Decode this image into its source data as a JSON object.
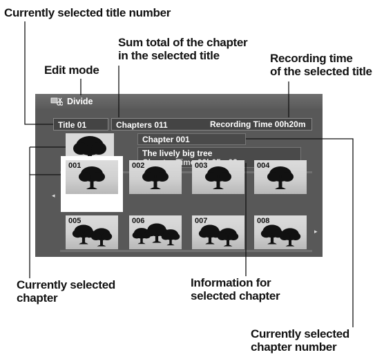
{
  "callouts": {
    "title_number": "Currently selected title number",
    "sum_chapters_line1": "Sum total of the chapter",
    "sum_chapters_line2": "in the selected title",
    "recording_time_line1": "Recording time",
    "recording_time_line2": "of the selected title",
    "edit_mode": "Edit mode",
    "selected_chapter_line1": "Currently selected",
    "selected_chapter_line2": "chapter",
    "info_line1": "Information for",
    "info_line2": "selected chapter",
    "chapter_number_line1": "Currently selected",
    "chapter_number_line2": "chapter number"
  },
  "screen": {
    "mode_icon": "scissors-icon",
    "mode_label": "Divide",
    "title": "Title 01",
    "chapters": "Chapters 011",
    "recording_time": "Recording Time  00h20m",
    "chapter_label": "Chapter 001",
    "chapter_name": "The lively big tree",
    "chapter_time": "Chapter Time  00h05m02s",
    "preview_icon": "tree-icon",
    "left_arrow_icon": "triangle-left-icon",
    "right_arrow_icon": "triangle-right-icon",
    "arrow_left": "◂",
    "arrow_right": "▸",
    "thumbnails": [
      {
        "num": "001",
        "trees": 1
      },
      {
        "num": "002",
        "trees": 1
      },
      {
        "num": "003",
        "trees": 1
      },
      {
        "num": "004",
        "trees": 1
      },
      {
        "num": "005",
        "trees": 2
      },
      {
        "num": "006",
        "trees": 3
      },
      {
        "num": "007",
        "trees": 2
      },
      {
        "num": "008",
        "trees": 2
      }
    ],
    "selected_index": 0
  }
}
